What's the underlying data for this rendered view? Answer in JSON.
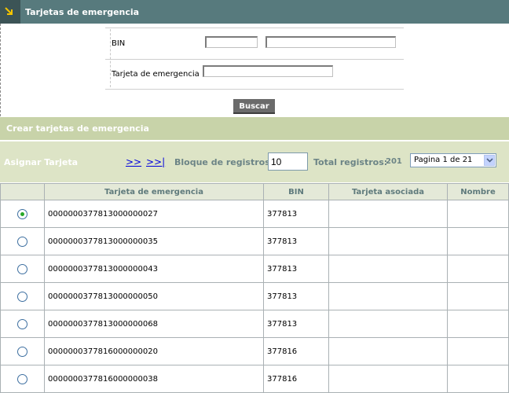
{
  "header": {
    "title": "Tarjetas de emergencia"
  },
  "form": {
    "bin_label": "BIN",
    "bin_value_1": "",
    "bin_value_2": "",
    "tarjeta_label": "Tarjeta de emergencia",
    "tarjeta_value": "",
    "search_label": "Buscar"
  },
  "section": {
    "title": "Crear tarjetas de emergencia"
  },
  "toolbar": {
    "assign_label": "Asignar Tarjeta",
    "next_label": ">>",
    "last_label": ">>|",
    "block_label": "Bloque de registros:",
    "block_value": "10",
    "total_label": "Total registros:",
    "total_value": "201",
    "page_select": "Pagina 1 de 21"
  },
  "table": {
    "columns": [
      "",
      "Tarjeta de emergencia",
      "BIN",
      "Tarjeta asociada",
      "Nombre"
    ],
    "rows": [
      {
        "selected": true,
        "tarjeta": "0000000377813000000027",
        "bin": "377813",
        "asociada": "",
        "nombre": ""
      },
      {
        "selected": false,
        "tarjeta": "0000000377813000000035",
        "bin": "377813",
        "asociada": "",
        "nombre": ""
      },
      {
        "selected": false,
        "tarjeta": "0000000377813000000043",
        "bin": "377813",
        "asociada": "",
        "nombre": ""
      },
      {
        "selected": false,
        "tarjeta": "0000000377813000000050",
        "bin": "377813",
        "asociada": "",
        "nombre": ""
      },
      {
        "selected": false,
        "tarjeta": "0000000377813000000068",
        "bin": "377813",
        "asociada": "",
        "nombre": ""
      },
      {
        "selected": false,
        "tarjeta": "0000000377816000000020",
        "bin": "377816",
        "asociada": "",
        "nombre": ""
      },
      {
        "selected": false,
        "tarjeta": "0000000377816000000038",
        "bin": "377816",
        "asociada": "",
        "nombre": ""
      }
    ]
  },
  "colors": {
    "header_bg": "#577a7d",
    "section_bg": "#c8d3a9",
    "toolbar_bg": "#dde4c6",
    "column_header_bg": "#e4e9d8",
    "label_teal": "#6c8486",
    "selected_radio": "#27a827"
  },
  "icons": {
    "header_icon": "corner-arrow-icon",
    "select_arrow": "chevron-down-icon"
  }
}
